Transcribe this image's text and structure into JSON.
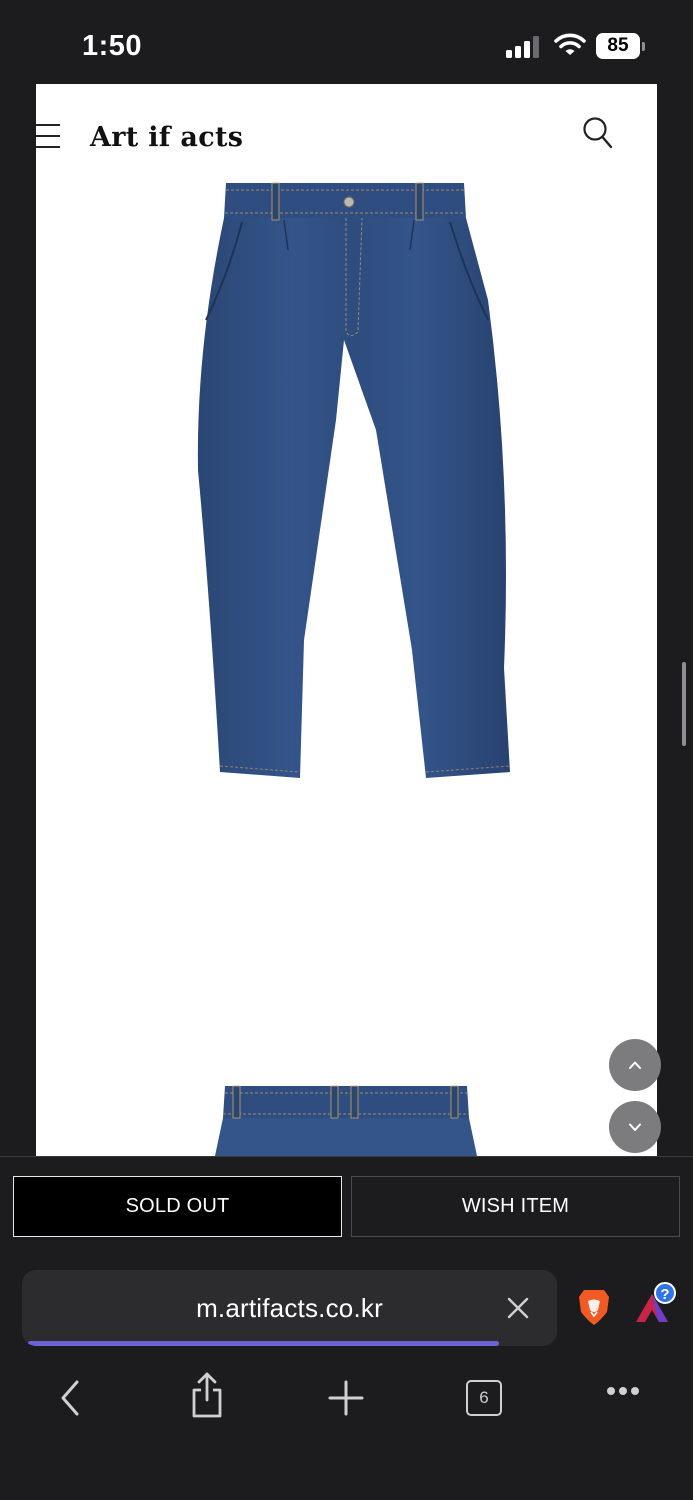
{
  "status_bar": {
    "time": "1:50",
    "battery": "85"
  },
  "site": {
    "brand": "Art if acts"
  },
  "product_bar": {
    "sold_out_label": "SOLD OUT",
    "wish_label": "WISH ITEM"
  },
  "browser": {
    "url": "m.artifacts.co.kr",
    "tab_count": "6",
    "load_progress": 0.88
  },
  "colors": {
    "denim": "#2f4d7e",
    "accent_progress": "#6c63d9",
    "brave_orange": "#f15a24"
  },
  "icons": [
    "menu-icon",
    "search-icon",
    "chevron-up-icon",
    "chevron-down-icon",
    "close-icon",
    "brave-lion-icon",
    "brave-rewards-icon",
    "back-icon",
    "share-icon",
    "add-icon",
    "tabs-icon",
    "more-icon",
    "signal-icon",
    "wifi-icon"
  ]
}
